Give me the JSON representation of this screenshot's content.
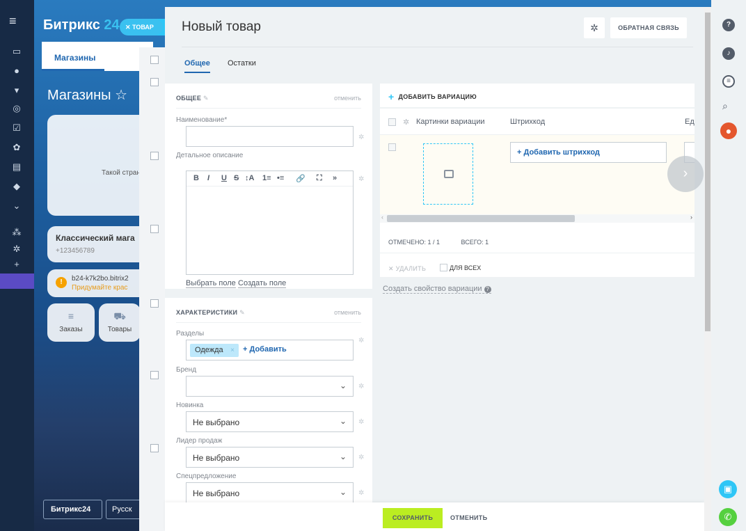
{
  "background": {
    "brand_name": "Битрикс",
    "brand_num": "24",
    "chip_label": "ТОВАР",
    "tab_label": "Магазины",
    "heading": "Магазины",
    "card1_text": "Такой стран",
    "card2_title": "Классический мага",
    "card2_phone": "+123456789",
    "card3_line1": "b24-k7k2bo.bitrix2",
    "card3_line2": "Придумайте крас",
    "orders_label": "Заказы",
    "goods_label": "Товары",
    "footer_brand": "Битрикс24",
    "footer_lang": "Русск"
  },
  "slider": {
    "title": "Новый товар",
    "feedback_label": "ОБРАТНАЯ СВЯЗЬ",
    "tabs": [
      {
        "label": "Общее"
      },
      {
        "label": "Остатки"
      }
    ]
  },
  "general": {
    "title": "ОБЩЕЕ",
    "cancel": "отменить",
    "name_label": "Наименование*",
    "name_value": "",
    "desc_label": "Детальное описание",
    "toolbar": [
      "B",
      "I",
      "U",
      "S",
      "↕A",
      "1≡",
      "•≡",
      "🔗",
      "⛶",
      "»"
    ],
    "choose_field": "Выбрать поле",
    "create_field": "Создать поле"
  },
  "chars": {
    "title": "ХАРАКТЕРИСТИКИ",
    "cancel": "отменить",
    "sections_label": "Разделы",
    "section_tag": "Одежда",
    "add_section": "+ Добавить",
    "brand_label": "Бренд",
    "brand_value": "",
    "novelty_label": "Новинка",
    "novelty_value": "Не выбрано",
    "leader_label": "Лидер продаж",
    "leader_value": "Не выбрано",
    "special_label": "Спецпредложение",
    "special_value": "Не выбрано"
  },
  "variations": {
    "add_variation": "ДОБАВИТЬ ВАРИАЦИЮ",
    "col_images": "Картинки вариации",
    "col_barcode": "Штрихкод",
    "col_unit": "Ед",
    "add_barcode": "+ Добавить штрихкод",
    "marked": "ОТМЕЧЕНО: 1 / 1",
    "total": "ВСЕГО: 1",
    "delete": "УДАЛИТЬ",
    "for_all": "ДЛЯ ВСЕХ",
    "create_prop": "Создать свойство вариации"
  },
  "footer": {
    "save": "СОХРАНИТЬ",
    "cancel": "ОТМЕНИТЬ"
  },
  "colors": {
    "accent": "#2fc6f6",
    "link": "#2067b0",
    "save": "#bbed21"
  }
}
